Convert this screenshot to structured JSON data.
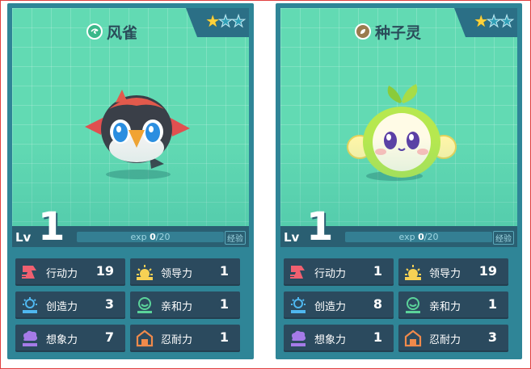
{
  "cards": [
    {
      "name": "风雀",
      "element_icon": "wind-icon",
      "stars_filled": 1,
      "stars_total": 3,
      "level_label": "Lv",
      "level": "1",
      "exp_label": "exp",
      "exp_current": "0",
      "exp_max": "/20",
      "detail_label": "经验",
      "stats": {
        "action": {
          "label": "行动力",
          "value": "19"
        },
        "leadership": {
          "label": "领导力",
          "value": "1"
        },
        "creativity": {
          "label": "创造力",
          "value": "3"
        },
        "affinity": {
          "label": "亲和力",
          "value": "1"
        },
        "imagination": {
          "label": "想象力",
          "value": "7"
        },
        "endurance": {
          "label": "忍耐力",
          "value": "1"
        }
      },
      "colors": {
        "accent": "#3bb88a"
      }
    },
    {
      "name": "种子灵",
      "element_icon": "seed-icon",
      "stars_filled": 1,
      "stars_total": 3,
      "level_label": "Lv",
      "level": "1",
      "exp_label": "exp",
      "exp_current": "0",
      "exp_max": "/20",
      "detail_label": "经验",
      "stats": {
        "action": {
          "label": "行动力",
          "value": "1"
        },
        "leadership": {
          "label": "领导力",
          "value": "19"
        },
        "creativity": {
          "label": "创造力",
          "value": "8"
        },
        "affinity": {
          "label": "亲和力",
          "value": "1"
        },
        "imagination": {
          "label": "想象力",
          "value": "1"
        },
        "endurance": {
          "label": "忍耐力",
          "value": "3"
        }
      },
      "colors": {
        "accent": "#9a7b4f"
      }
    }
  ],
  "colors": {
    "card_bg": "#2f8597",
    "art_bg": "#62dab3",
    "stat_bg": "#2b4a5e",
    "star": "#ffd23a"
  }
}
